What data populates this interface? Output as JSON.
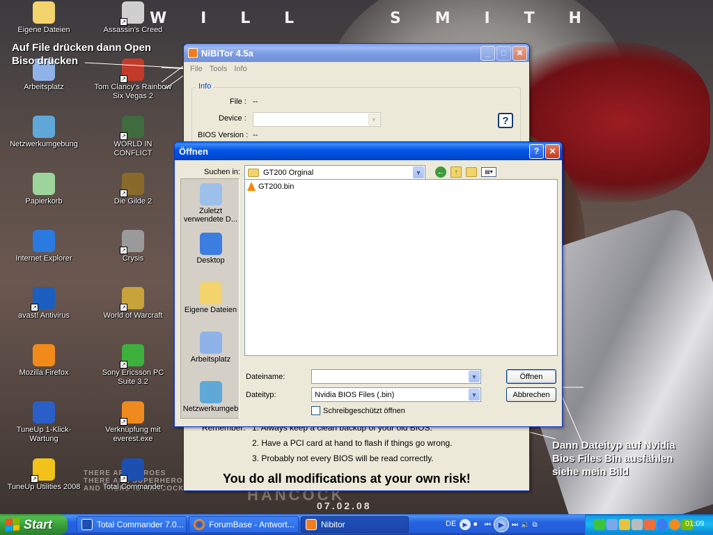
{
  "wallpaper": {
    "title_letters": [
      "W",
      "I",
      "L",
      "L",
      "S",
      "M",
      "I",
      "T",
      "H"
    ],
    "hero_text": [
      "THERE ARE HEROES",
      "THERE ARE SUPERHEROES",
      "AND THERE IS HANCOCK"
    ],
    "movie": "HANCOCK",
    "date": "07.02.08"
  },
  "desktop_icons": [
    {
      "label": "Eigene Dateien",
      "icon": "my-documents-icon",
      "shortcut": false
    },
    {
      "label": "Assassin's Creed",
      "icon": "assassins-creed-icon",
      "shortcut": true
    },
    {
      "label": "Arbeitsplatz",
      "icon": "my-computer-icon",
      "shortcut": false
    },
    {
      "label": "Tom Clancy's Rainbow Six Vegas 2",
      "icon": "rainbow-six-icon",
      "shortcut": true
    },
    {
      "label": "Netzwerkumgebung",
      "icon": "network-icon",
      "shortcut": false
    },
    {
      "label": "WORLD IN CONFLICT",
      "icon": "world-in-conflict-icon",
      "shortcut": true
    },
    {
      "label": "Papierkorb",
      "icon": "recycle-bin-icon",
      "shortcut": false
    },
    {
      "label": "Die Gilde 2",
      "icon": "die-gilde-icon",
      "shortcut": true
    },
    {
      "label": "Internet Explorer",
      "icon": "internet-explorer-icon",
      "shortcut": false
    },
    {
      "label": "Crysis",
      "icon": "crysis-icon",
      "shortcut": true
    },
    {
      "label": "avast! Antivirus",
      "icon": "avast-icon",
      "shortcut": true
    },
    {
      "label": "World of Warcraft",
      "icon": "wow-icon",
      "shortcut": true
    },
    {
      "label": "Mozilla Firefox",
      "icon": "firefox-icon",
      "shortcut": false
    },
    {
      "label": "Sony Ericsson PC Suite 3.2",
      "icon": "sony-ericsson-icon",
      "shortcut": true
    },
    {
      "label": "TuneUp 1-Klick-Wartung",
      "icon": "tuneup-wartung-icon",
      "shortcut": false
    },
    {
      "label": "Verknüpfung mit everest.exe",
      "icon": "everest-icon",
      "shortcut": true
    },
    {
      "label": "TuneUp Utilities 2008",
      "icon": "tuneup-utilities-icon",
      "shortcut": true
    },
    {
      "label": "Total Commander",
      "icon": "total-commander-icon",
      "shortcut": true
    }
  ],
  "annotations": {
    "top_note": "Auf File drücken dann Open Biso drücken",
    "bottom_note": "Dann Dateityp auf Nvidia Bios Files Bin ausfählen siehe mein Bild"
  },
  "nibitor": {
    "title": "NiBiTor 4.5a",
    "menu": [
      "File",
      "Tools",
      "Info"
    ],
    "group_title": "Info",
    "file_label": "File :",
    "file_value": "--",
    "device_label": "Device :",
    "device_value": "",
    "bios_label": "BIOS Version :",
    "bios_value": "--",
    "help_label": "?",
    "remember_title": "Remember:",
    "remember_items": [
      "1. Always keep a clean backup of your old BIOS.",
      "2. Have a PCI card at hand to flash if things go wrong.",
      "3. Probably not every BIOS will be read correctly."
    ],
    "risk": "You do all modifications at your own risk!"
  },
  "open_dialog": {
    "title": "Öffnen",
    "help": "?",
    "close": "✕",
    "look_in_label": "Suchen in:",
    "look_in_value": "GT200 Orginal",
    "places": [
      {
        "label": "Zuletzt verwendete D...",
        "icon": "recent-documents-icon"
      },
      {
        "label": "Desktop",
        "icon": "desktop-icon"
      },
      {
        "label": "Eigene Dateien",
        "icon": "my-documents-icon"
      },
      {
        "label": "Arbeitsplatz",
        "icon": "my-computer-icon"
      },
      {
        "label": "Netzwerkumgeb",
        "icon": "network-places-icon"
      }
    ],
    "files": [
      {
        "name": "GT200.bin",
        "icon": "vlc-cone-icon"
      }
    ],
    "filename_label": "Dateiname:",
    "filename_value": "",
    "filetype_label": "Dateityp:",
    "filetype_value": "Nvidia BIOS Files (.bin)",
    "readonly_label": "Schreibgeschützt öffnen",
    "open_button": "Öffnen",
    "cancel_button": "Abbrechen"
  },
  "taskbar": {
    "start_label": "Start",
    "tasks": [
      {
        "label": "Total Commander 7.0...",
        "icon": "total-commander-icon",
        "active": false
      },
      {
        "label": "ForumBase - Antwort...",
        "icon": "firefox-icon",
        "active": false
      },
      {
        "label": "Nibitor",
        "icon": "nibitor-icon",
        "active": true
      }
    ],
    "language": "DE",
    "clock": "01:09"
  }
}
